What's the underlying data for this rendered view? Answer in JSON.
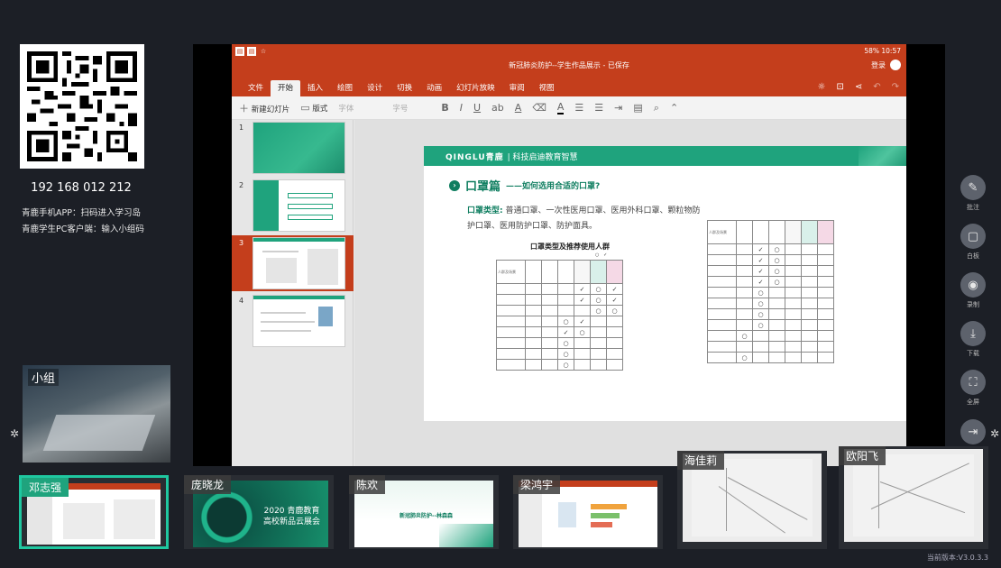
{
  "left_panel": {
    "ip": "192 168 012 212",
    "hint_app": "青鹿手机APP：扫码进入学习岛",
    "hint_pc": "青鹿学生PC客户端：输入小组码",
    "camera_name": "小组"
  },
  "ppt": {
    "doc_title": "新冠肺炎防护--学生作品展示 - 已保存",
    "status": "58% 10:57",
    "login": "登录",
    "tabs": [
      "文件",
      "开始",
      "插入",
      "绘图",
      "设计",
      "切换",
      "动画",
      "幻灯片放映",
      "审阅",
      "视图"
    ],
    "active_tab": "开始",
    "toolbar": {
      "new_slide": "新建幻灯片",
      "layout": "版式",
      "font": "字体",
      "font_size": "字号",
      "bold": "B",
      "italic": "I",
      "underline": "U",
      "strike": "ab",
      "font_color": "A"
    },
    "thumb_numbers": [
      "1",
      "2",
      "3",
      "4"
    ],
    "selected_slide": "3",
    "slide": {
      "brand": "QINGLU青鹿",
      "tagline": "| 科技启迪教育智慧",
      "title": "口罩篇",
      "subtitle": "——如何选用合适的口罩?",
      "body_keyword": "口罩类型:",
      "body_text": " 普通口罩、一次性医用口罩、医用外科口罩、颗粒物防护口罩、医用防护口罩、防护面具。",
      "table_title": "口罩类型及推荐使用人群",
      "check": "✓",
      "circle": "○",
      "table_header": "人群及场景"
    }
  },
  "right_tools": [
    {
      "icon": "annotate-icon",
      "glyph": "✎",
      "label": "批注"
    },
    {
      "icon": "whiteboard-icon",
      "glyph": "▢",
      "label": "白板"
    },
    {
      "icon": "record-icon",
      "glyph": "◉",
      "label": "录制"
    },
    {
      "icon": "download-icon",
      "glyph": "⤓",
      "label": "下载"
    },
    {
      "icon": "fullscreen-icon",
      "glyph": "⛶",
      "label": "全屏"
    },
    {
      "icon": "exit-icon",
      "glyph": "⇥",
      "label": ""
    }
  ],
  "students": [
    {
      "name": "邓志强"
    },
    {
      "name": "庞晓龙",
      "content": "2020 青鹿教育\n高校新品云展会"
    },
    {
      "name": "陈欢",
      "content": "新冠肺炎防护--林森森"
    },
    {
      "name": "梁鸿宇"
    },
    {
      "name": "海佳莉"
    },
    {
      "name": "欧阳飞"
    }
  ],
  "version": "当前版本:V3.0.3.3"
}
